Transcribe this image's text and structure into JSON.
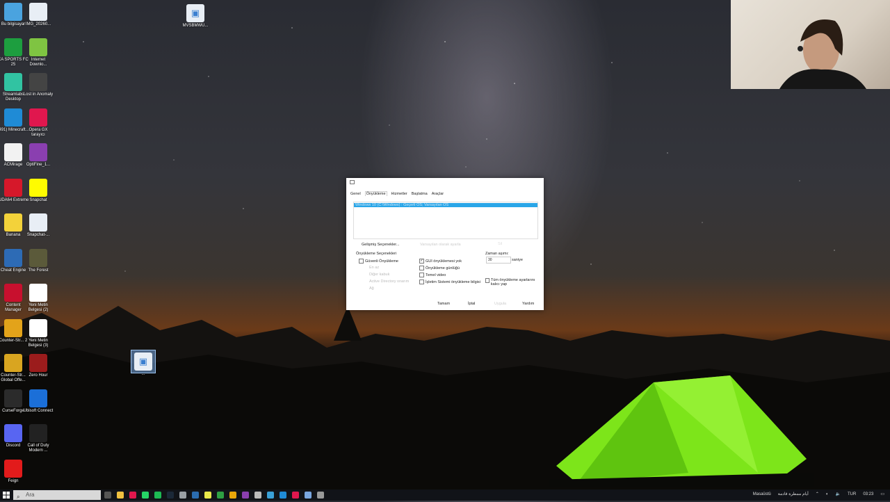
{
  "desktop": {
    "icons_left": [
      {
        "label": "Bu bilgisayar",
        "icon": "computer-icon",
        "color": "#4aa3df"
      },
      {
        "label": "IMG_20260...",
        "icon": "image-file-icon",
        "color": "#e8eef5"
      },
      {
        "label": "EA SPORTS FC 25",
        "icon": "ea-fc-icon",
        "color": "#1d9e3f"
      },
      {
        "label": "Internet Downlo...",
        "icon": "idm-icon",
        "color": "#7fc442"
      },
      {
        "label": "Streamlabs Desktop",
        "icon": "streamlabs-icon",
        "color": "#31c3a2"
      },
      {
        "label": "Lost in Anomaly",
        "icon": "game-icon",
        "color": "#444"
      },
      {
        "label": "(491) Minecraft...",
        "icon": "edge-icon",
        "color": "#1f8bd6"
      },
      {
        "label": "Opera GX tarayıcı",
        "icon": "opera-gx-icon",
        "color": "#e0174e"
      },
      {
        "label": "ACMirage",
        "icon": "file-icon",
        "color": "#f2f2f2"
      },
      {
        "label": "OptiFine_1...",
        "icon": "winrar-icon",
        "color": "#8a3fb0"
      },
      {
        "label": "AIDA64 Extreme",
        "icon": "aida64-icon",
        "color": "#d6182a"
      },
      {
        "label": "Snapchat",
        "icon": "snapchat-icon",
        "color": "#fffc00"
      },
      {
        "label": "Banana",
        "icon": "banana-icon",
        "color": "#f3d23a"
      },
      {
        "label": "Snapchat-...",
        "icon": "image-file-icon",
        "color": "#e8eef5"
      },
      {
        "label": "Cheat Engine",
        "icon": "cheat-engine-icon",
        "color": "#2d6bb5"
      },
      {
        "label": "The Forest",
        "icon": "the-forest-icon",
        "color": "#5b5a3a"
      },
      {
        "label": "Content Manager",
        "icon": "content-manager-icon",
        "color": "#c8102e"
      },
      {
        "label": "Yeni Metin Belgesi (2)",
        "icon": "text-file-icon",
        "color": "#ffffff"
      },
      {
        "label": "Counter-Str... 2",
        "icon": "cs2-icon",
        "color": "#e3a31a"
      },
      {
        "label": "Yeni Metin Belgesi (3)",
        "icon": "text-file-icon",
        "color": "#ffffff"
      },
      {
        "label": "Counter-Str... Global Offe...",
        "icon": "csgo-icon",
        "color": "#d9a520"
      },
      {
        "label": "Zero Hour",
        "icon": "zero-hour-icon",
        "color": "#9b1c1c"
      },
      {
        "label": "CurseForge",
        "icon": "curseforge-icon",
        "color": "#2b2b2b"
      },
      {
        "label": "Ubisoft Connect",
        "icon": "ubisoft-icon",
        "color": "#1b6fd8"
      },
      {
        "label": "Discord",
        "icon": "discord-icon",
        "color": "#5865f2"
      },
      {
        "label": "Call of Duty Modern ...",
        "icon": "cod-icon",
        "color": "#222"
      },
      {
        "label": "Feign",
        "icon": "feign-icon",
        "color": "#e21b1b"
      }
    ],
    "icon_top": {
      "label": "MVSBMWU...",
      "icon": "image-file-icon"
    },
    "icon_selected": {
      "label": "...",
      "icon": "image-file-icon"
    }
  },
  "dialog": {
    "tabs": [
      "Genel",
      "Önyükleme",
      "Hizmetler",
      "Başlatma",
      "Araçlar"
    ],
    "active_tab": "Önyükleme",
    "os_entry": "Windows 10 (C:\\Windows) : Geçerli OS; Varsayılan OS",
    "advanced_button": "Gelişmiş Seçenekler...",
    "set_default_button": "Varsayılan olarak ayarla",
    "delete_button": "Sil",
    "boot_options_title": "Önyükleme Seçenekleri",
    "safe_boot": "Güvenli Önyükleme",
    "safe_sub": [
      "En az",
      "Diğer kabuk",
      "Active Directory onarım",
      "Ağ"
    ],
    "gui_no_boot": "GUI önyüklemesi yok",
    "boot_log": "Önyükleme günlüğü",
    "base_video": "Temel video",
    "os_boot_info": "İşletim Sistemi önyükleme bilgisi",
    "timeout_label": "Zaman aşımı:",
    "timeout_value": "30",
    "timeout_unit": "saniye",
    "permanent": "Tüm önyükleme ayarlarını kalıcı yap",
    "ok": "Tamam",
    "cancel": "İptal",
    "apply": "Uygula",
    "help": "Yardım"
  },
  "taskbar": {
    "search_placeholder": "Ara",
    "desktop_label": "Masaüstü",
    "weather_text": "أيام ممطرة قادمة",
    "language": "TUR",
    "time": "03:23"
  }
}
